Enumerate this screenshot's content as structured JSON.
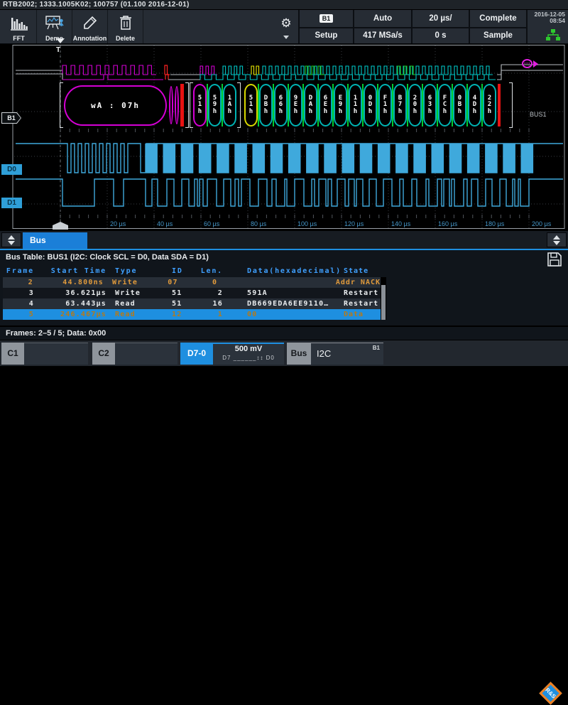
{
  "title_bar": {
    "text": "RTB2002; 1333.1005K02; 100757 (01.100 2016-12-01)"
  },
  "toolbar": {
    "buttons": [
      {
        "id": "fft",
        "label": "FFT"
      },
      {
        "id": "demo",
        "label": "Demo"
      },
      {
        "id": "annotation",
        "label": "Annotation"
      },
      {
        "id": "delete",
        "label": "Delete"
      }
    ]
  },
  "status": {
    "b1_badge": "B1",
    "setup": "Setup",
    "trigger_mode": "Auto",
    "sample_rate": "417 MSa/s",
    "timebase": "20 µs/",
    "horizontal_position": "0 s",
    "acquisition_status": "Complete",
    "acquisition_mode": "Sample",
    "date": "2016-12-05",
    "time": "08:54"
  },
  "waveform": {
    "trigger_label": "T",
    "b1_marker": "B1",
    "d0_label": "D0",
    "d1_label": "D1",
    "bus_label": "BUS1",
    "address_frame": "wA : 07h",
    "frames": [
      {
        "text": "51h",
        "color": "#d400d4"
      },
      {
        "text": "59h",
        "color": "#00b4b4"
      },
      {
        "text": "1Ah",
        "color": "#00b4b4"
      },
      {
        "text": "51h",
        "color": "#d8d800"
      },
      {
        "text": "DBh",
        "color": "#00b4b4"
      },
      {
        "text": "66h",
        "color": "#00b4b4"
      },
      {
        "text": "9Eh",
        "color": "#00b4b4"
      },
      {
        "text": "DAh",
        "color": "#00b4b4"
      },
      {
        "text": "6Eh",
        "color": "#00b4b4"
      },
      {
        "text": "E9h",
        "color": "#00b4b4"
      },
      {
        "text": "11h",
        "color": "#00b4b4"
      },
      {
        "text": "0Dh",
        "color": "#00b4b4"
      },
      {
        "text": "F1h",
        "color": "#00b4b4"
      },
      {
        "text": "B7h",
        "color": "#00b4b4"
      },
      {
        "text": "20h",
        "color": "#00b4b4"
      },
      {
        "text": "63h",
        "color": "#00b4b4"
      },
      {
        "text": "FCh",
        "color": "#00b4b4"
      },
      {
        "text": "0Bh",
        "color": "#00b4b4"
      },
      {
        "text": "4Dh",
        "color": "#00b4b4"
      },
      {
        "text": "22h",
        "color": "#00b4b4"
      }
    ],
    "time_labels": [
      "20 µs",
      "40 µs",
      "60 µs",
      "80 µs",
      "100 µs",
      "120 µs",
      "140 µs",
      "160 µs",
      "180 µs",
      "200 µs"
    ]
  },
  "tab_bar": {
    "tab_label": "Bus"
  },
  "bus_table": {
    "title": "Bus Table: BUS1 (I2C: Clock SCL = D0, Data SDA = D1)",
    "columns": [
      "Frame",
      "Start Time",
      "Type",
      "ID",
      "Len.",
      "Data(hexadecimal)",
      "State"
    ],
    "rows": [
      {
        "frame": "2",
        "start_time": "44.800ns",
        "type": "Write",
        "id": "07",
        "len": "0",
        "data": "",
        "state": "Addr NACK",
        "highlight": "orange"
      },
      {
        "frame": "3",
        "start_time": "36.621µs",
        "type": "Write",
        "id": "51",
        "len": "2",
        "data": "591A",
        "state": "Restart",
        "highlight": "none"
      },
      {
        "frame": "4",
        "start_time": "63.443µs",
        "type": "Read",
        "id": "51",
        "len": "16",
        "data": "DB669EDA6EE9110…",
        "state": "Restart",
        "highlight": "none"
      },
      {
        "frame": "5",
        "start_time": "246.467µs",
        "type": "Read",
        "id": "12",
        "len": "1",
        "data": "00",
        "state": "Data",
        "highlight": "selected"
      }
    ],
    "summary": "Frames:  2–5 / 5;  Data: 0x00"
  },
  "bottom_bar": {
    "c1_label": "C1",
    "c2_label": "C2",
    "d_group_label": "D7-0",
    "d_group_value": "500 mV",
    "d_group_range": "D7 ______↕↕ D0",
    "bus_label": "Bus",
    "bus_type": "I2C",
    "bus_badge": "B1"
  },
  "colors": {
    "accent": "#1e8fe0",
    "trace_blue": "#3fa9dc",
    "orange": "#e09a3c",
    "header_blue": "#3fa0ff",
    "magenta": "#d400d4",
    "cyan": "#00b4b4",
    "yellow": "#d8d800",
    "green": "#00cc33",
    "red": "#e81212"
  }
}
